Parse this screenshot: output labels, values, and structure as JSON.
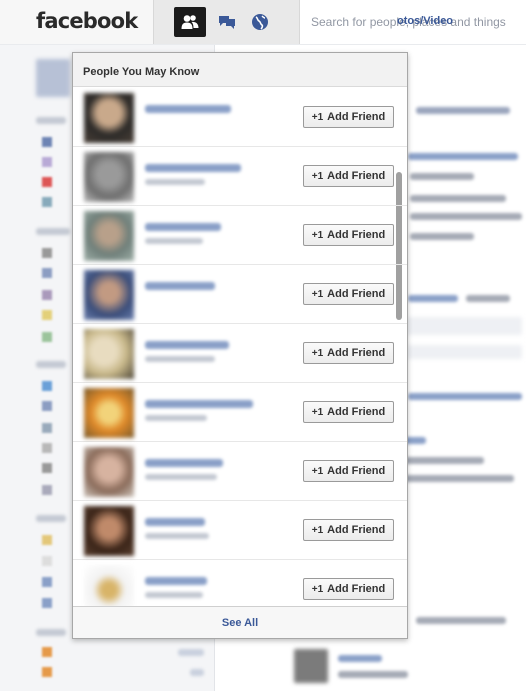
{
  "header": {
    "logo_text": "facebook",
    "search_placeholder": "Search for people, places and things"
  },
  "icons": {
    "friends": "friend-requests-icon",
    "messages": "messages-icon",
    "notifications": "notifications-globe-icon"
  },
  "colors": {
    "brand_blue": "#3b5998",
    "topbar_bg": "#f7f7f7",
    "friends_jewel_bg": "#1b1b1b"
  },
  "background": {
    "tab_label": "otos/Video"
  },
  "dropdown": {
    "title": "People You May Know",
    "see_all_label": "See All",
    "add_friend_plus": "+1",
    "people": [
      {
        "add_label": "Add Friend"
      },
      {
        "add_label": "Add Friend"
      },
      {
        "add_label": "Add Friend"
      },
      {
        "add_label": "Add Friend"
      },
      {
        "add_label": "Add Friend"
      },
      {
        "add_label": "Add Friend"
      },
      {
        "add_label": "Add Friend"
      },
      {
        "add_label": "Add Friend"
      },
      {
        "add_label": "Add Friend"
      }
    ]
  }
}
